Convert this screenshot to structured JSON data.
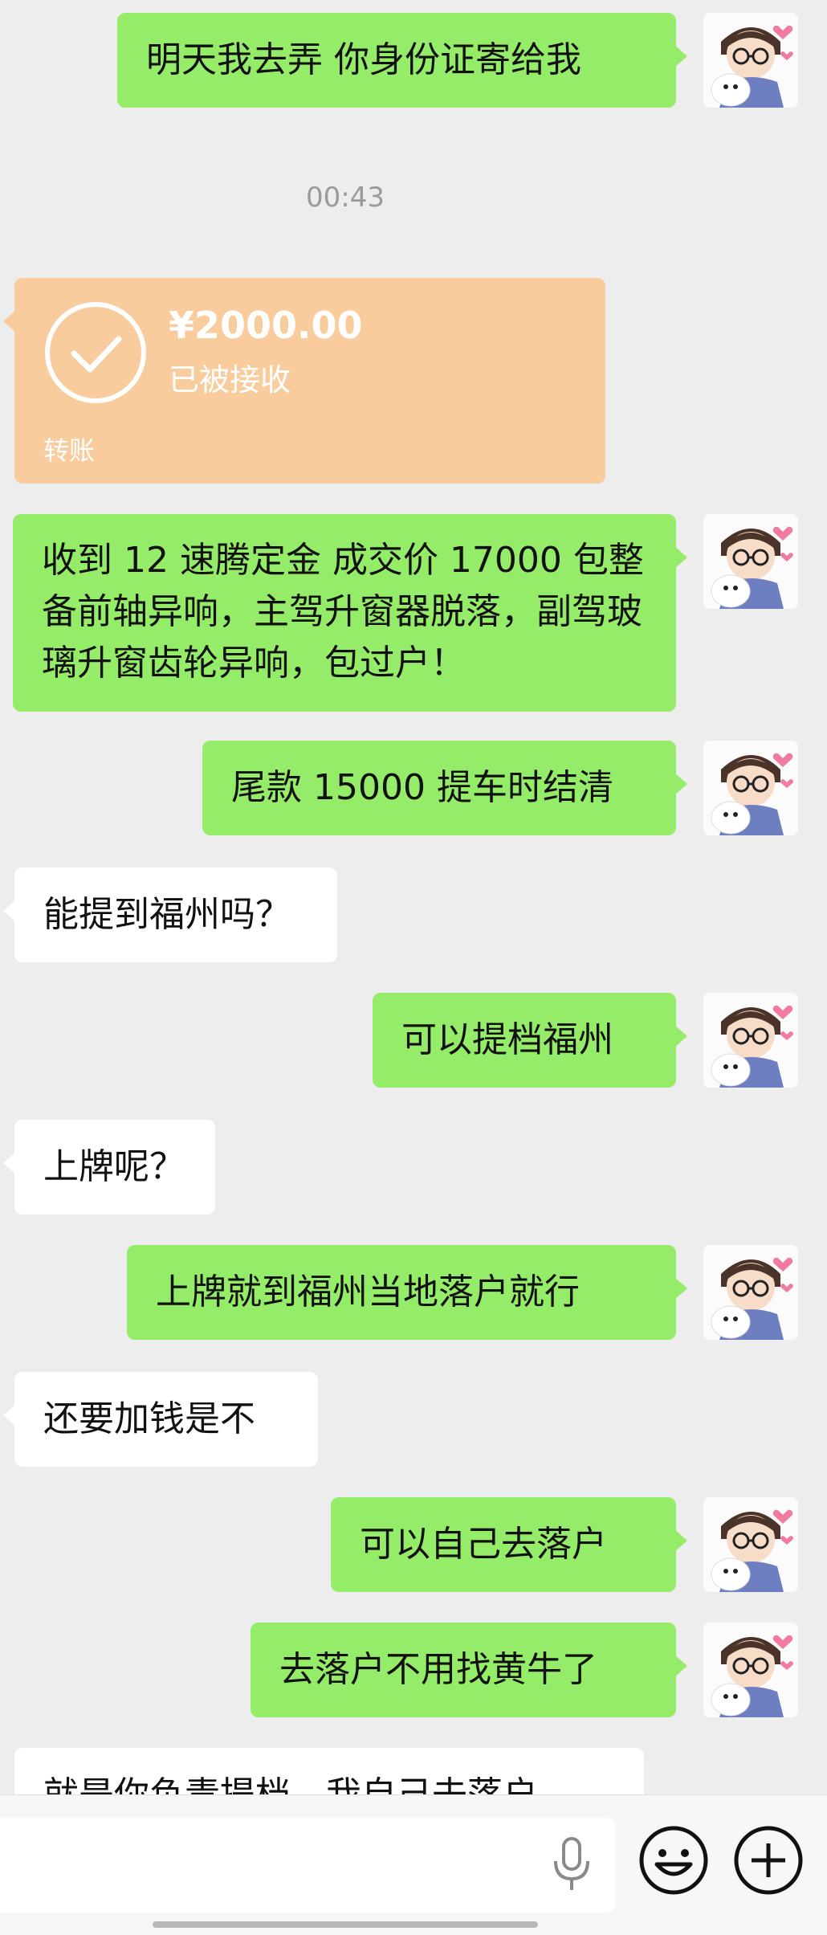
{
  "messages": {
    "m1": "明天我去弄 你身份证寄给我",
    "time": "00:43",
    "transfer": {
      "amount": "¥2000.00",
      "status": "已被接收",
      "label": "转账"
    },
    "m2": "收到 12 速腾定金 成交价 17000 包整备前轴异响，主驾升窗器脱落，副驾玻璃升窗齿轮异响，包过户！",
    "m3": "尾款 15000 提车时结清",
    "m4": "能提到福州吗？",
    "m5": "可以提档福州",
    "m6": "上牌呢？",
    "m7": "上牌就到福州当地落户就行",
    "m8": "还要加钱是不",
    "m9": "可以自己去落户",
    "m10": "去落户不用找黄牛了",
    "m11": "就是你负责提档，我自己去落户"
  },
  "colors": {
    "sent_bubble": "#95ec69",
    "received_bubble": "#ffffff",
    "transfer_card": "#f9cc9d",
    "background": "#ededed"
  },
  "icons": {
    "avatar": "avatar-icon",
    "voice": "microphone-icon",
    "emoji": "emoji-icon",
    "more": "plus-icon",
    "check": "check-circle-icon"
  }
}
